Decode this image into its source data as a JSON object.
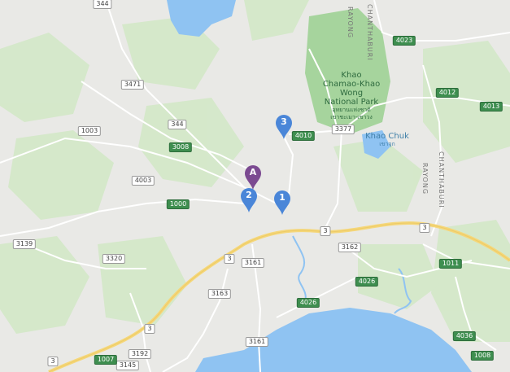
{
  "map": {
    "route_shields": [
      {
        "label": "344",
        "style": "white"
      },
      {
        "label": "3471",
        "style": "white"
      },
      {
        "label": "344",
        "style": "white"
      },
      {
        "label": "1003",
        "style": "white"
      },
      {
        "label": "3008",
        "style": "green"
      },
      {
        "label": "4003",
        "style": "white"
      },
      {
        "label": "1000",
        "style": "green"
      },
      {
        "label": "3139",
        "style": "white"
      },
      {
        "label": "3320",
        "style": "white"
      },
      {
        "label": "3161",
        "style": "white"
      },
      {
        "label": "3163",
        "style": "white"
      },
      {
        "label": "3",
        "style": "white"
      },
      {
        "label": "3",
        "style": "white"
      },
      {
        "label": "3",
        "style": "white"
      },
      {
        "label": "3",
        "style": "white"
      },
      {
        "label": "3",
        "style": "white"
      },
      {
        "label": "3192",
        "style": "white"
      },
      {
        "label": "3145",
        "style": "white"
      },
      {
        "label": "1007",
        "style": "green"
      },
      {
        "label": "3161",
        "style": "white"
      },
      {
        "label": "3162",
        "style": "white"
      },
      {
        "label": "4026",
        "style": "green"
      },
      {
        "label": "4026",
        "style": "green"
      },
      {
        "label": "4010",
        "style": "green"
      },
      {
        "label": "3377",
        "style": "white"
      },
      {
        "label": "4023",
        "style": "green"
      },
      {
        "label": "4012",
        "style": "green"
      },
      {
        "label": "4013",
        "style": "green"
      },
      {
        "label": "1011",
        "style": "green"
      },
      {
        "label": "4036",
        "style": "green"
      },
      {
        "label": "1008",
        "style": "green"
      }
    ],
    "places": {
      "park": {
        "name_lines": [
          "Khao",
          "Chamao-Khao",
          "Wong",
          "National Park"
        ],
        "thai_lines": [
          "อุทยานแห่งชาติ",
          "เขาชะเมา-เขาวง"
        ]
      },
      "khao_chuk": {
        "name": "Khao Chuk",
        "thai": "เขาจุก"
      }
    },
    "road_names": [
      "RAYONG",
      "CHANTHABURI",
      "CHANTHABURI",
      "RAYONG"
    ],
    "markers": [
      {
        "label": "A",
        "color": "#7b4a91"
      },
      {
        "label": "2",
        "color": "#4a86d8"
      },
      {
        "label": "1",
        "color": "#4a86d8"
      },
      {
        "label": "3",
        "color": "#4a86d8"
      }
    ],
    "colors": {
      "land": "#e9e9e6",
      "forest": "#cfe6c4",
      "park": "#9dcf96",
      "water": "#8fc3f2",
      "highway": "#f5d77a"
    }
  }
}
